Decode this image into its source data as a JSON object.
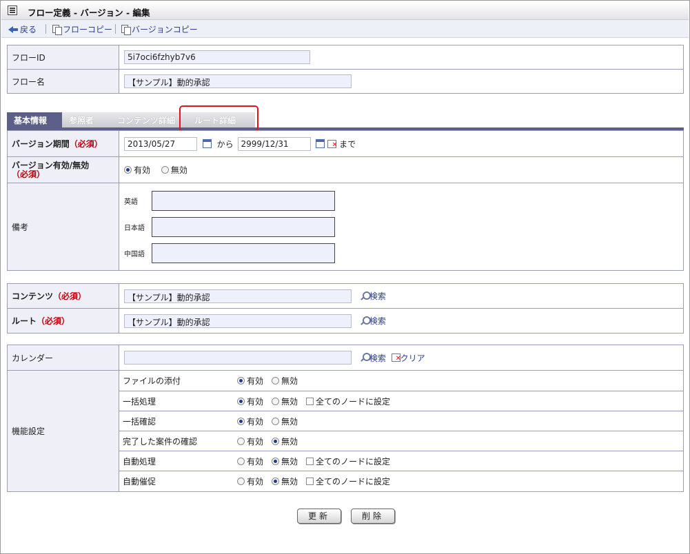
{
  "title": "フロー定義 - バージョン - 編集",
  "toolbar": {
    "back": "戻る",
    "flow_copy": "フローコピー",
    "version_copy": "バージョンコピー"
  },
  "flow": {
    "id_label": "フローID",
    "id_value": "5i7oci6fzhyb7v6",
    "name_label": "フロー名",
    "name_value": "【サンプル】動的承認"
  },
  "tabs": [
    "基本情報",
    "参照者",
    "コンテンツ詳細",
    "ルート詳細"
  ],
  "version": {
    "period_label": "バージョン期間",
    "required": "（必須）",
    "start": "2013/05/27",
    "from": "から",
    "end": "2999/12/31",
    "until": "まで",
    "valid_label": "バージョン有効/無効",
    "valid_on": "有効",
    "valid_off": "無効",
    "remarks_label": "備考",
    "lang_en": "英語",
    "lang_ja": "日本語",
    "lang_zh": "中国語"
  },
  "content": {
    "label": "コンテンツ",
    "value": "【サンプル】動的承認",
    "search": "検索"
  },
  "route": {
    "label": "ルート",
    "value": "【サンプル】動的承認",
    "search": "検索"
  },
  "calendar": {
    "label": "カレンダー",
    "value": "",
    "search": "検索",
    "clear": "クリア"
  },
  "features": {
    "label": "機能設定",
    "on": "有効",
    "off": "無効",
    "all_nodes": "全てのノードに設定",
    "rows": [
      {
        "name": "ファイルの添付"
      },
      {
        "name": "一括処理"
      },
      {
        "name": "一括確認"
      },
      {
        "name": "完了した案件の確認"
      },
      {
        "name": "自動処理"
      },
      {
        "name": "自動催促"
      }
    ]
  },
  "buttons": {
    "update": "更新",
    "delete": "削除"
  }
}
